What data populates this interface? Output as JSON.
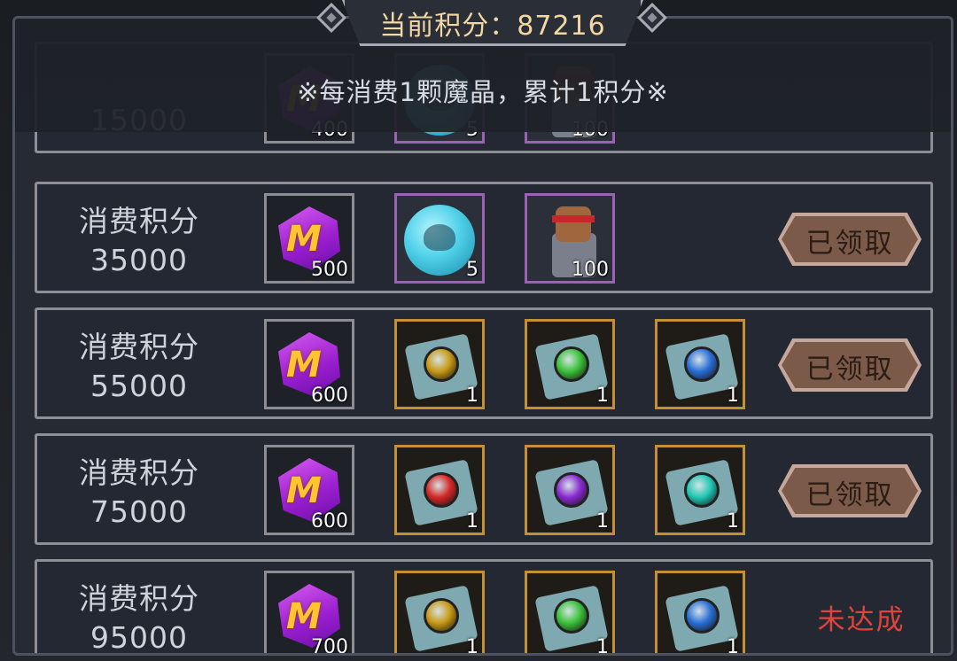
{
  "header": {
    "score_label": "当前积分：87216",
    "notice": "※每消费1颗魔晶，累计1积分※"
  },
  "rows": [
    {
      "label_line1": "",
      "label_value": "15000",
      "items": [
        {
          "type": "gem",
          "count": "400"
        },
        {
          "type": "skull",
          "count": "5"
        },
        {
          "type": "hero",
          "count": "100"
        }
      ]
    },
    {
      "label_line1": "消费积分",
      "label_value": "35000",
      "items": [
        {
          "type": "gem",
          "count": "500"
        },
        {
          "type": "skull",
          "count": "5"
        },
        {
          "type": "hero",
          "count": "100"
        }
      ],
      "status": "已领取"
    },
    {
      "label_line1": "消费积分",
      "label_value": "55000",
      "items": [
        {
          "type": "gem",
          "count": "600"
        },
        {
          "type": "scroll",
          "rune_color": "#c89a16",
          "count": "1"
        },
        {
          "type": "scroll",
          "rune_color": "#3cc23a",
          "count": "1"
        },
        {
          "type": "scroll",
          "rune_color": "#2a6fd6",
          "count": "1"
        }
      ],
      "status": "已领取"
    },
    {
      "label_line1": "消费积分",
      "label_value": "75000",
      "items": [
        {
          "type": "gem",
          "count": "600"
        },
        {
          "type": "scroll",
          "rune_color": "#d52828",
          "count": "1"
        },
        {
          "type": "scroll",
          "rune_color": "#8a2bd0",
          "count": "1"
        },
        {
          "type": "scroll",
          "rune_color": "#22c8b4",
          "count": "1"
        }
      ],
      "status": "已领取"
    },
    {
      "label_line1": "消费积分",
      "label_value": "95000",
      "items": [
        {
          "type": "gem",
          "count": "700"
        },
        {
          "type": "scroll",
          "rune_color": "#c89a16",
          "count": "1"
        },
        {
          "type": "scroll",
          "rune_color": "#3cc23a",
          "count": "1"
        },
        {
          "type": "scroll",
          "rune_color": "#2a6fd6",
          "count": "1"
        }
      ],
      "status": "未达成"
    }
  ]
}
